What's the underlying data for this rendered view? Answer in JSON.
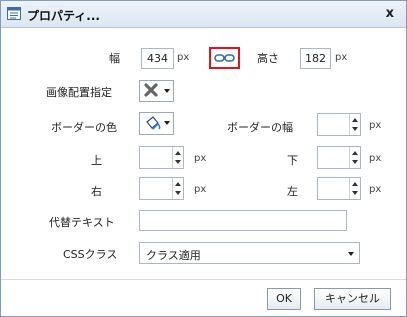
{
  "dialog": {
    "title": "プロパティ...",
    "close_label": "x"
  },
  "size": {
    "width_label": "幅",
    "width_value": "434",
    "width_unit": "px",
    "height_label": "高さ",
    "height_value": "182",
    "height_unit": "px"
  },
  "placement": {
    "label": "画像配置指定"
  },
  "border": {
    "color_label": "ボーダーの色",
    "width_label": "ボーダーの幅",
    "width_value": "",
    "width_unit": "px"
  },
  "margins": {
    "top_label": "上",
    "top_value": "",
    "top_unit": "px",
    "bottom_label": "下",
    "bottom_value": "",
    "bottom_unit": "px",
    "right_label": "右",
    "right_value": "",
    "right_unit": "px",
    "left_label": "左",
    "left_value": "",
    "left_unit": "px"
  },
  "alt": {
    "label": "代替テキスト",
    "value": ""
  },
  "css": {
    "label": "CSSクラス",
    "selected": "クラス適用"
  },
  "buttons": {
    "ok": "OK",
    "cancel": "キャンセル"
  },
  "colors": {
    "titlebar": "#dce6f2",
    "lock_highlight": "#e0141f",
    "border": "#aab6c4"
  },
  "icons": {
    "title": "properties-icon",
    "lock": "link-lock-icon",
    "placement": "no-placement-x-icon",
    "color": "paint-bucket-icon"
  }
}
